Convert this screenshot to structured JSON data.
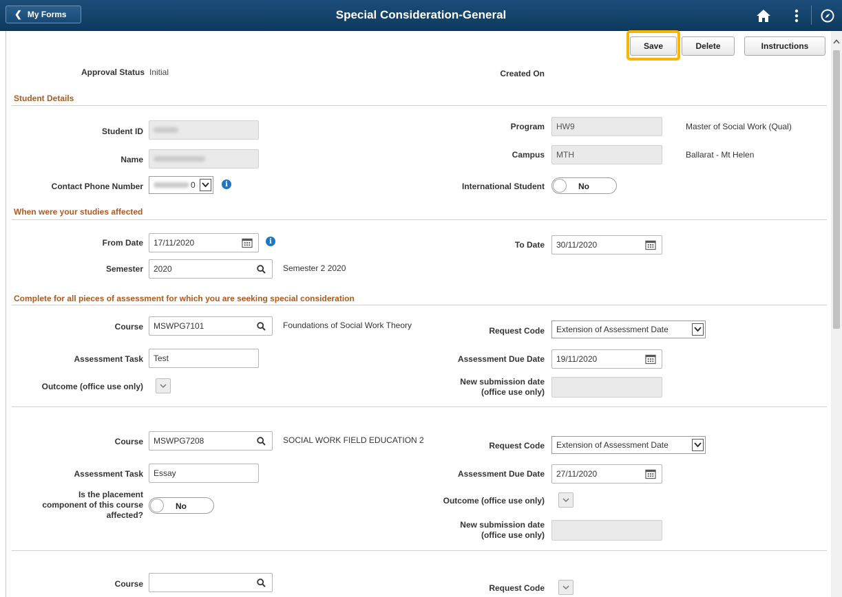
{
  "header": {
    "back_label": "My Forms",
    "title": "Special Consideration-General"
  },
  "toolbar": {
    "save": "Save",
    "delete": "Delete",
    "instructions": "Instructions"
  },
  "status": {
    "approval_label": "Approval Status",
    "approval_value": "Initial",
    "created_label": "Created On",
    "created_value": ""
  },
  "student": {
    "section": "Student Details",
    "id_label": "Student ID",
    "name_label": "Name",
    "phone_label": "Contact Phone Number",
    "phone_suffix": "0",
    "program_label": "Program",
    "program_code": "HW9",
    "program_desc": "Master of Social Work (Qual)",
    "campus_label": "Campus",
    "campus_code": "MTH",
    "campus_desc": "Ballarat - Mt Helen",
    "intl_label": "International Student",
    "intl_value": "No"
  },
  "studies": {
    "section": "When were your studies affected",
    "from_label": "From Date",
    "from_value": "17/11/2020",
    "to_label": "To Date",
    "to_value": "30/11/2020",
    "semester_label": "Semester",
    "semester_value": "2020",
    "semester_desc": "Semester 2 2020"
  },
  "assess": {
    "section": "Complete for all pieces of assessment for which you are seeking special consideration",
    "rows": [
      {
        "course_label": "Course",
        "course_value": "MSWPG7101",
        "course_desc": "Foundations of Social Work Theory",
        "request_label": "Request Code",
        "request_value": "Extension of Assessment Date",
        "task_label": "Assessment Task",
        "task_value": "Test",
        "due_label": "Assessment Due Date",
        "due_value": "19/11/2020",
        "outcome_label": "Outcome (office use only)",
        "newsub_label_1": "New submission date",
        "newsub_label_2": "(office use only)"
      },
      {
        "course_label": "Course",
        "course_value": "MSWPG7208",
        "course_desc": "SOCIAL WORK FIELD EDUCATION 2",
        "request_label": "Request Code",
        "request_value": "Extension of Assessment Date",
        "task_label": "Assessment Task",
        "task_value": "Essay",
        "due_label": "Assessment Due Date",
        "due_value": "27/11/2020",
        "placement_label_1": "Is the placement",
        "placement_label_2": "component of this course",
        "placement_label_3": "affected?",
        "placement_value": "No",
        "outcome_label": "Outcome (office use only)",
        "newsub_label_1": "New submission date",
        "newsub_label_2": "(office use only)"
      },
      {
        "course_label": "Course",
        "course_value": "",
        "request_label": "Request Code"
      }
    ]
  }
}
